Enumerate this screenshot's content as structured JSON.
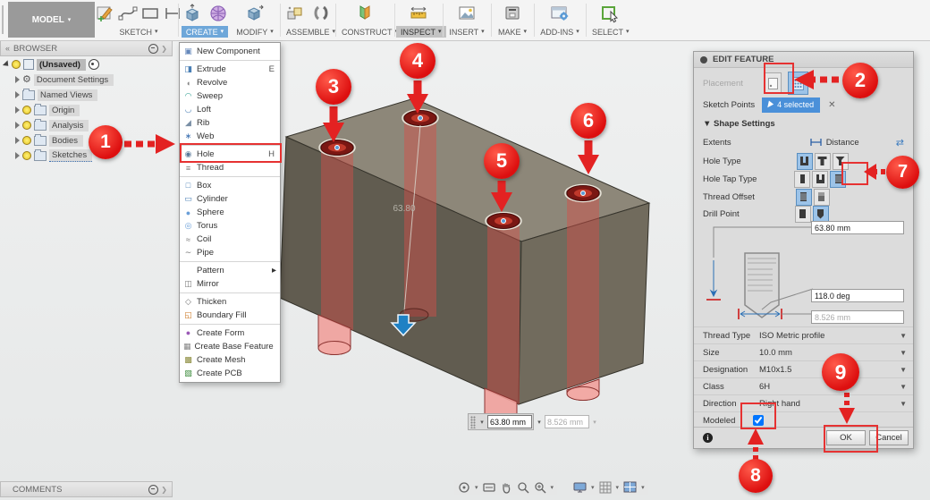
{
  "toolbar": {
    "model_label": "MODEL",
    "groups": [
      {
        "label": "SKETCH"
      },
      {
        "label": "CREATE"
      },
      {
        "label": "MODIFY"
      },
      {
        "label": "ASSEMBLE"
      },
      {
        "label": "CONSTRUCT"
      },
      {
        "label": "INSPECT"
      },
      {
        "label": "INSERT"
      },
      {
        "label": "MAKE"
      },
      {
        "label": "ADD-INS"
      },
      {
        "label": "SELECT"
      }
    ]
  },
  "browser": {
    "title": "BROWSER",
    "root_label": "(Unsaved)",
    "items": [
      {
        "label": "Document Settings"
      },
      {
        "label": "Named Views"
      },
      {
        "label": "Origin"
      },
      {
        "label": "Analysis"
      },
      {
        "label": "Bodies"
      },
      {
        "label": "Sketches"
      }
    ]
  },
  "create_menu": {
    "items": [
      {
        "label": "New Component",
        "glyph": "▣",
        "color": "#6688bb"
      },
      {
        "label": "Extrude",
        "shortcut": "E",
        "glyph": "◨",
        "color": "#4a7fb5",
        "divider": true
      },
      {
        "label": "Revolve",
        "glyph": "◖",
        "color": "#888888"
      },
      {
        "label": "Sweep",
        "glyph": "◠",
        "color": "#2a9d8f"
      },
      {
        "label": "Loft",
        "glyph": "◡",
        "color": "#4a7fb5"
      },
      {
        "label": "Rib",
        "glyph": "◢",
        "color": "#7a8fa5"
      },
      {
        "label": "Web",
        "glyph": "∗",
        "color": "#3a6fb0"
      },
      {
        "label": "Hole",
        "shortcut": "H",
        "glyph": "◉",
        "color": "#5a7a9a",
        "divider": true,
        "highlight": true
      },
      {
        "label": "Thread",
        "glyph": "≡",
        "color": "#777777"
      },
      {
        "label": "Box",
        "glyph": "□",
        "color": "#4a7fb5",
        "divider": true
      },
      {
        "label": "Cylinder",
        "glyph": "▭",
        "color": "#4a7fb5"
      },
      {
        "label": "Sphere",
        "glyph": "●",
        "color": "#6a9fd8"
      },
      {
        "label": "Torus",
        "glyph": "◎",
        "color": "#6a9fd8"
      },
      {
        "label": "Coil",
        "glyph": "≈",
        "color": "#777777"
      },
      {
        "label": "Pipe",
        "glyph": "∼",
        "color": "#777777"
      },
      {
        "label": "Pattern",
        "submenu": true,
        "divider": true
      },
      {
        "label": "Mirror",
        "glyph": "◫",
        "color": "#777777"
      },
      {
        "label": "Thicken",
        "glyph": "◇",
        "color": "#777777",
        "divider": true
      },
      {
        "label": "Boundary Fill",
        "glyph": "◱",
        "color": "#cc7722"
      },
      {
        "label": "Create Form",
        "glyph": "●",
        "color": "#9b59b6",
        "divider": true
      },
      {
        "label": "Create Base Feature",
        "glyph": "▦",
        "color": "#888888"
      },
      {
        "label": "Create Mesh",
        "glyph": "▩",
        "color": "#8a8a3a"
      },
      {
        "label": "Create PCB",
        "glyph": "▧",
        "color": "#3a8a3a"
      }
    ]
  },
  "canvas": {
    "depth_dimension_text": "63.80",
    "depth_input_value": "63.80 mm",
    "diameter_input_value": "8.526 mm"
  },
  "edit_feature": {
    "title": "EDIT FEATURE",
    "placement_label": "Placement",
    "sketch_points_label": "Sketch Points",
    "sketch_points_value": "4 selected",
    "shape_settings_label": "▼ Shape Settings",
    "extents_label": "Extents",
    "extents_value": "Distance",
    "hole_type_label": "Hole Type",
    "hole_tap_type_label": "Hole Tap Type",
    "thread_offset_label": "Thread Offset",
    "drill_point_label": "Drill Point",
    "depth_value": "63.80 mm",
    "angle_value": "118.0 deg",
    "tap_diameter_value": "8.526 mm",
    "selects": [
      {
        "label": "Thread Type",
        "value": "ISO Metric profile"
      },
      {
        "label": "Size",
        "value": "10.0 mm"
      },
      {
        "label": "Designation",
        "value": "M10x1.5"
      },
      {
        "label": "Class",
        "value": "6H"
      },
      {
        "label": "Direction",
        "value": "Right hand"
      }
    ],
    "modeled_label": "Modeled",
    "ok_label": "OK",
    "cancel_label": "Cancel"
  },
  "callouts": {
    "c1": "1",
    "c2": "2",
    "c3": "3",
    "c4": "4",
    "c5": "5",
    "c6": "6",
    "c7": "7",
    "c8": "8",
    "c9": "9"
  },
  "comments": {
    "title": "COMMENTS"
  },
  "colors": {
    "callout_red": "#dd0f0f",
    "highlight_red": "#e63232",
    "selection_blue": "#4a90d9",
    "create_tab_blue": "#6ea7d9",
    "inspect_pressed_gray": "#c3c3c3"
  }
}
